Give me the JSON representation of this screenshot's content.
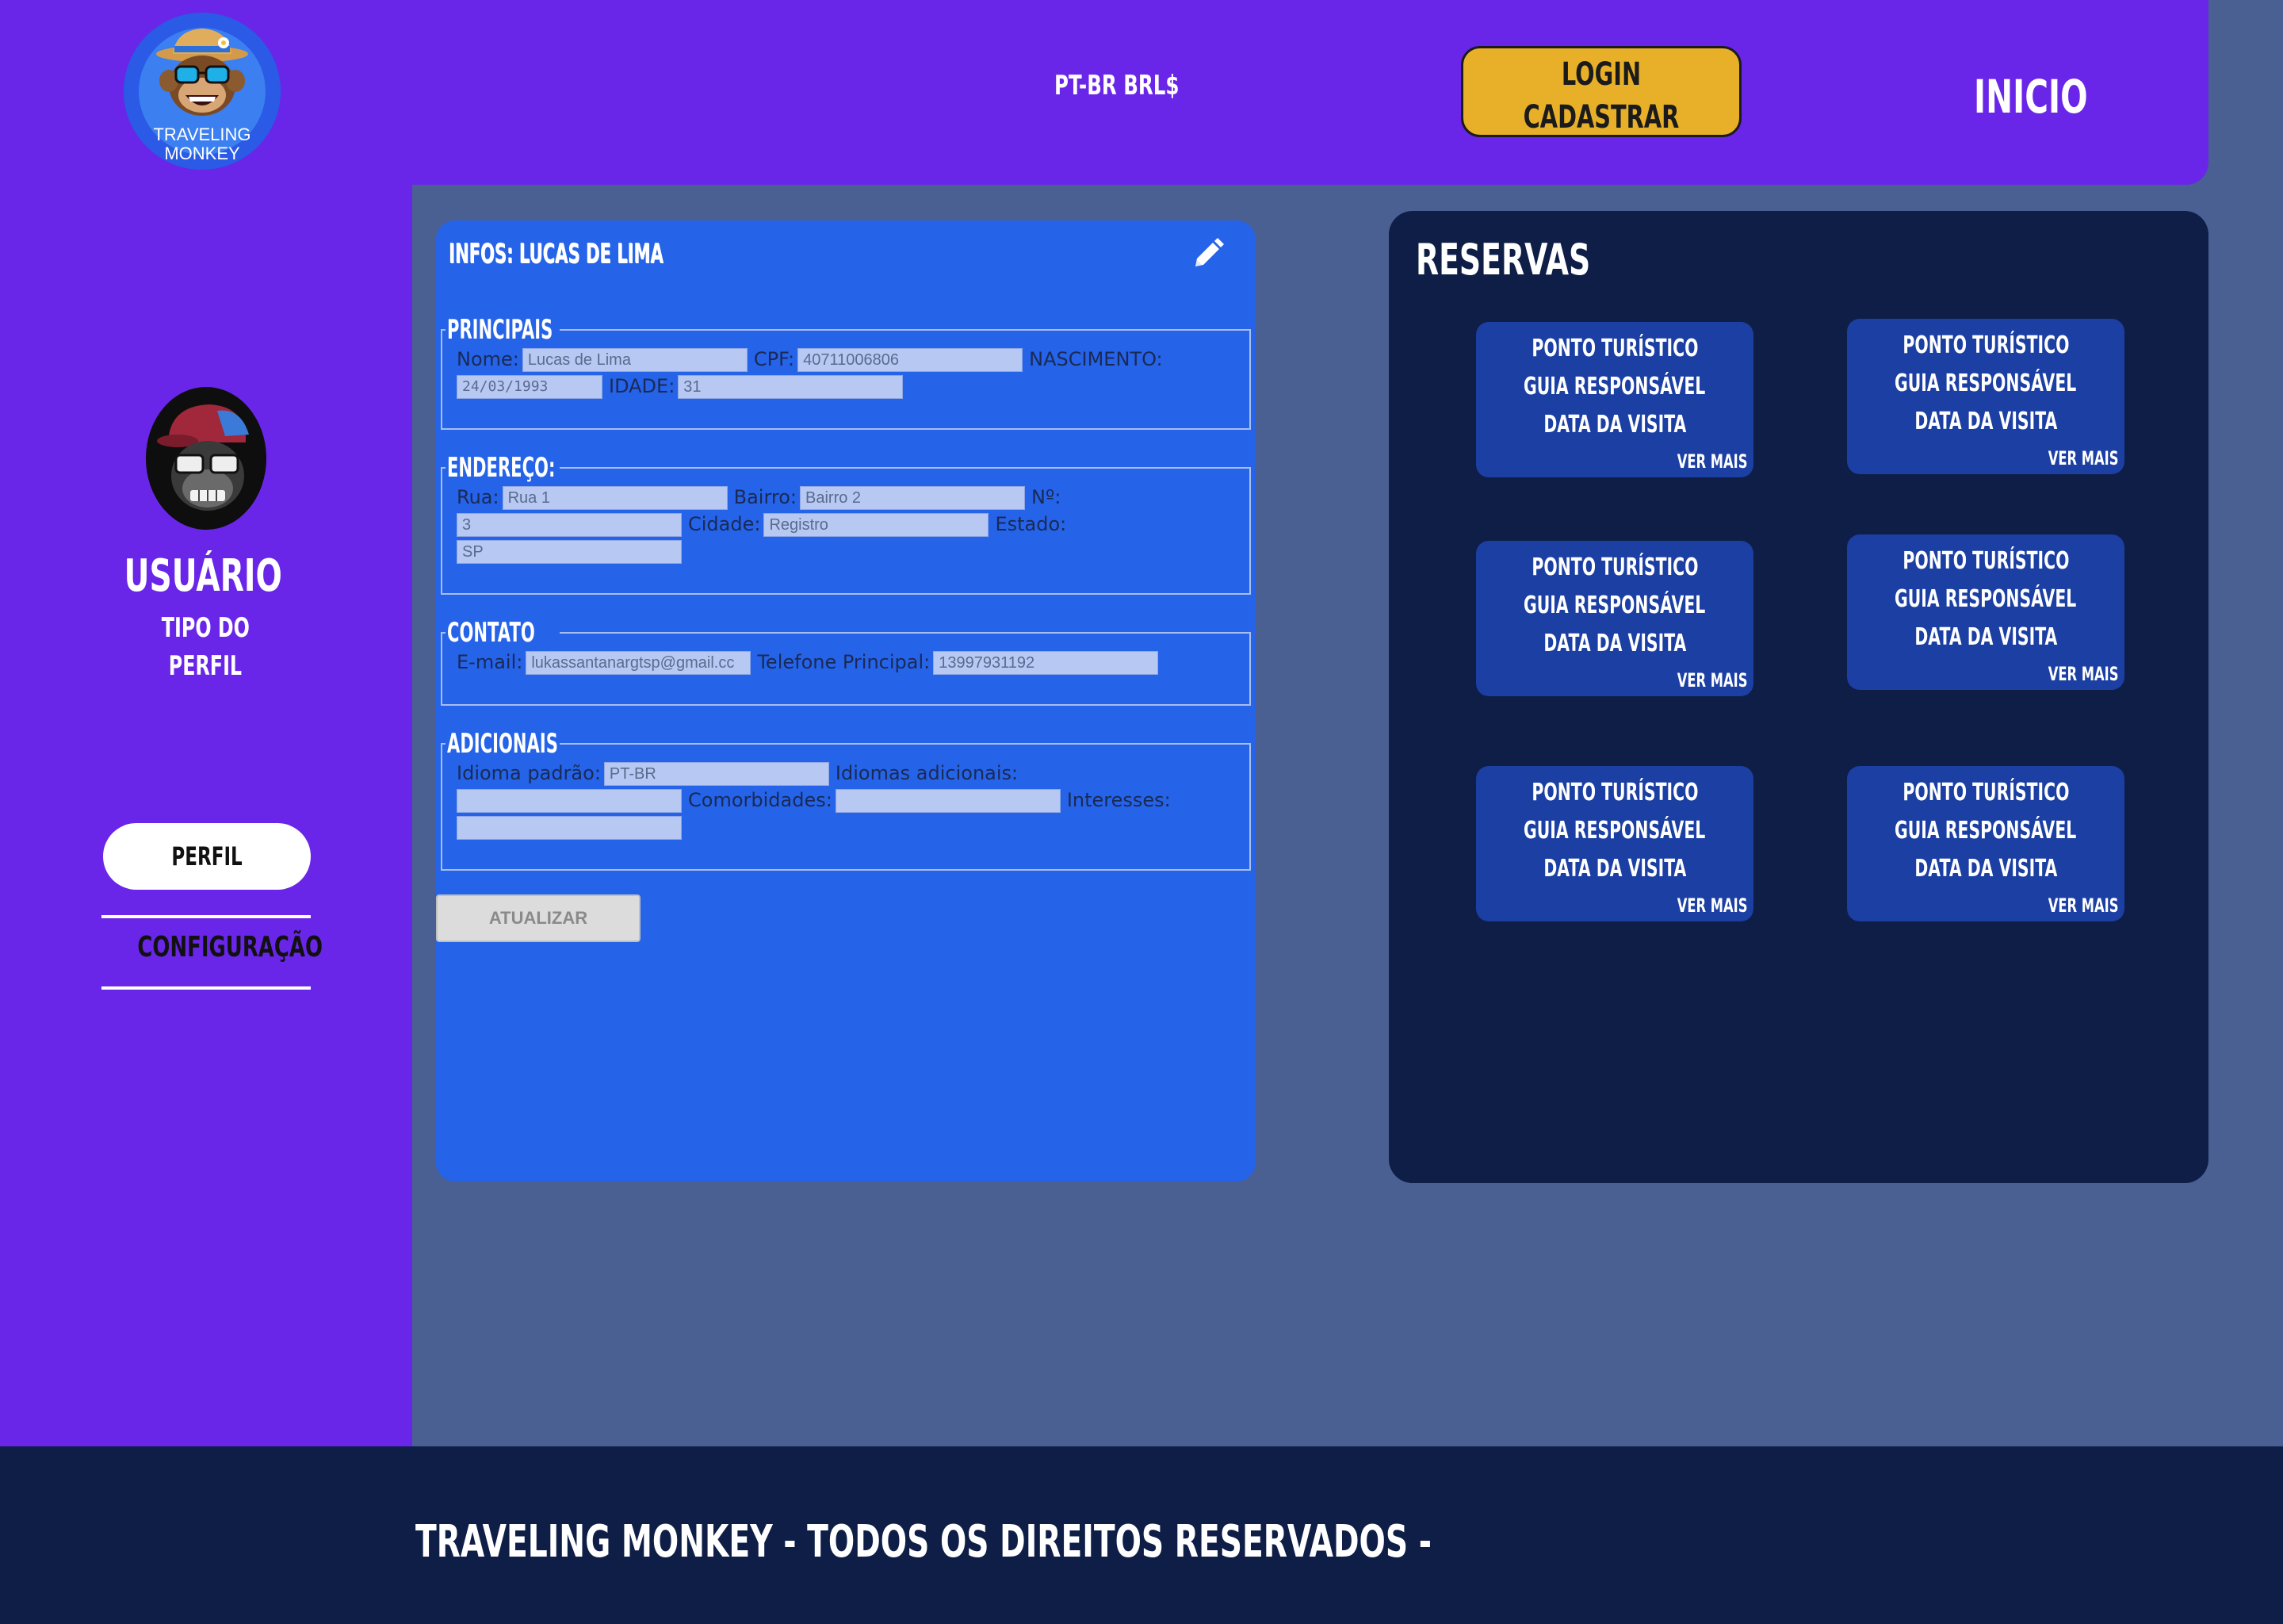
{
  "header": {
    "logo_line1": "TRAVELING",
    "logo_line2": "MONKEY",
    "lang_currency": "PT-BR BRL$",
    "login_label": "LOGIN",
    "signup_label": "CADASTRAR",
    "home_label": "INICIO"
  },
  "sidebar": {
    "user_name": "USUÁRIO",
    "user_type_line1": "TIPO DO",
    "user_type_line2": "PERFIL",
    "profile_button": "PERFIL",
    "settings_link": "CONFIGURAÇÃO"
  },
  "info": {
    "title": "INFOS: LUCAS DE LIMA",
    "principais": {
      "legend": "PRINCIPAIS",
      "nome_label": "Nome:",
      "nome_value": "Lucas de Lima",
      "cpf_label": "CPF:",
      "cpf_value": "40711006806",
      "nascimento_label": "NASCIMENTO:",
      "nascimento_value": "24/03/1993",
      "idade_label": "IDADE:",
      "idade_value": "31"
    },
    "endereco": {
      "legend": "ENDEREÇO:",
      "rua_label": "Rua:",
      "rua_value": "Rua 1",
      "bairro_label": "Bairro:",
      "bairro_value": "Bairro 2",
      "numero_label": "Nº:",
      "numero_value": "3",
      "cidade_label": "Cidade:",
      "cidade_value": "Registro",
      "estado_label": "Estado:",
      "estado_value": "SP"
    },
    "contato": {
      "legend": "CONTATO",
      "email_label": "E-mail:",
      "email_value": "lukassantanargtsp@gmail.cc",
      "telefone_label": "Telefone Principal:",
      "telefone_value": "13997931192"
    },
    "adicionais": {
      "legend": "ADICIONAIS",
      "idioma_label": "Idioma padrão:",
      "idioma_value": "PT-BR",
      "idiomas_add_label": "Idiomas adicionais:",
      "idiomas_add_value": "",
      "comorbidades_label": "Comorbidades:",
      "comorbidades_value": "",
      "interesses_label": "Interesses:",
      "interesses_value": ""
    },
    "update_button": "ATUALIZAR"
  },
  "reservas": {
    "title": "RESERVAS",
    "cards": [
      {
        "line1": "PONTO TURÍSTICO",
        "line2": "GUIA RESPONSÁVEL",
        "line3": "DATA DA VISITA",
        "more": "VER MAIS"
      },
      {
        "line1": "PONTO TURÍSTICO",
        "line2": "GUIA RESPONSÁVEL",
        "line3": "DATA DA VISITA",
        "more": "VER MAIS"
      },
      {
        "line1": "PONTO TURÍSTICO",
        "line2": "GUIA RESPONSÁVEL",
        "line3": "DATA DA VISITA",
        "more": "VER MAIS"
      },
      {
        "line1": "PONTO TURÍSTICO",
        "line2": "GUIA RESPONSÁVEL",
        "line3": "DATA DA VISITA",
        "more": "VER MAIS"
      },
      {
        "line1": "PONTO TURÍSTICO",
        "line2": "GUIA RESPONSÁVEL",
        "line3": "DATA DA VISITA",
        "more": "VER MAIS"
      },
      {
        "line1": "PONTO TURÍSTICO",
        "line2": "GUIA RESPONSÁVEL",
        "line3": "DATA DA VISITA",
        "more": "VER MAIS"
      }
    ]
  },
  "footer": {
    "text": "TRAVELING MONKEY - TODOS OS DIREITOS RESERVADOS -"
  },
  "colors": {
    "header_purple": "#6a26e8",
    "page_bg": "#4a6092",
    "card_blue": "#2563e8",
    "navy": "#0e1e47",
    "reserva_card": "#1b3fa2",
    "login_yellow": "#e8b028"
  },
  "icons": {
    "edit": "pencil-icon",
    "logo": "monkey-logo-icon",
    "avatar": "gorilla-avatar-icon"
  }
}
